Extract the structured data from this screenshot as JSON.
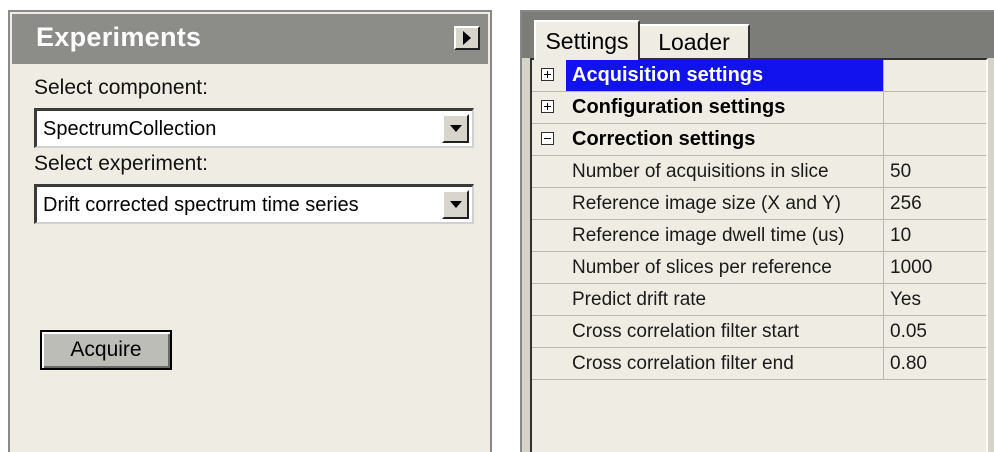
{
  "experiments": {
    "title": "Experiments",
    "collapse_icon": "triangle-right-icon",
    "component_label": "Select component:",
    "component_value": "SpectrumCollection",
    "experiment_label": "Select experiment:",
    "experiment_value": "Drift corrected spectrum time series",
    "acquire_label": "Acquire"
  },
  "settings": {
    "tabs": [
      {
        "label": "Settings",
        "active": true
      },
      {
        "label": "Loader",
        "active": false
      }
    ],
    "categories": [
      {
        "label": "Acquisition settings",
        "expander": "plus",
        "selected": true
      },
      {
        "label": "Configuration settings",
        "expander": "plus",
        "selected": false
      },
      {
        "label": "Correction settings",
        "expander": "minus",
        "selected": false
      }
    ],
    "properties": [
      {
        "name": "Number of acquisitions in slice",
        "value": "50"
      },
      {
        "name": "Reference image size (X and Y)",
        "value": "256"
      },
      {
        "name": "Reference image dwell time (us)",
        "value": "10"
      },
      {
        "name": "Number of slices per reference",
        "value": "1000"
      },
      {
        "name": "Predict drift rate",
        "value": "Yes"
      },
      {
        "name": "Cross correlation filter start",
        "value": "0.05"
      },
      {
        "name": "Cross correlation filter end",
        "value": "0.80"
      }
    ]
  },
  "colors": {
    "selection": "#1212ee",
    "panel_bg": "#efede3",
    "header_bg": "#8c8c88"
  }
}
